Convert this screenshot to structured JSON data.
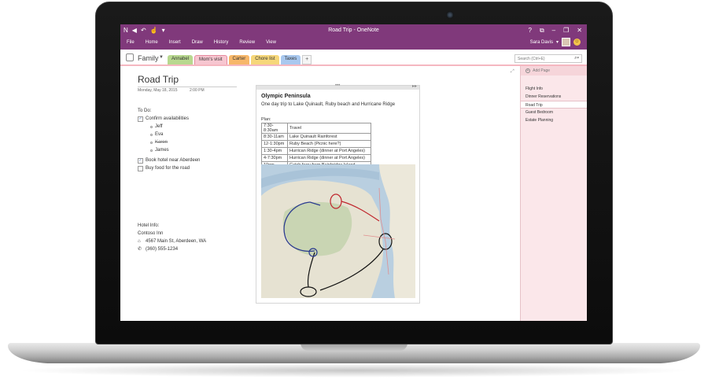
{
  "window": {
    "title": "Road Trip - OneNote",
    "qat_icons": [
      "onenote-logo-icon",
      "back-icon",
      "undo-icon",
      "touch-mode-icon",
      "customize-icon"
    ],
    "controls": [
      "help-icon",
      "fullscreen-icon",
      "minimize-icon",
      "restore-icon",
      "close-icon"
    ]
  },
  "ribbon": {
    "tabs": [
      "File",
      "Home",
      "Insert",
      "Draw",
      "History",
      "Review",
      "View"
    ],
    "user_name": "Sara Davis"
  },
  "notebook": {
    "name": "Family",
    "sections": [
      {
        "label": "Annabel",
        "color": "#b8d88f"
      },
      {
        "label": "Mom's visit",
        "color": "#f7c6d0"
      },
      {
        "label": "Carter",
        "color": "#f7b76a"
      },
      {
        "label": "Chore list",
        "color": "#f6d77a"
      },
      {
        "label": "Taxes",
        "color": "#a9c8ef"
      }
    ],
    "add_section": "+",
    "active_section": 1,
    "search_placeholder": "Search (Ctrl+E)"
  },
  "page": {
    "title": "Road Trip",
    "date": "Monday, May 18, 2015",
    "time": "2:00 PM",
    "todo_label": "To Do:",
    "todo": [
      {
        "text": "Confirm availabilities",
        "checked": true
      },
      {
        "text": "Jeff",
        "sub": true
      },
      {
        "text": "Eva",
        "sub": true
      },
      {
        "text": "Karen",
        "sub": true,
        "strike": true
      },
      {
        "text": "James",
        "sub": true
      },
      {
        "text": "Book hotel near Aberdeen",
        "checked": true
      },
      {
        "text": "Buy food for the road",
        "checked": false
      }
    ],
    "hotel_label": "Hotel Info:",
    "hotel_name": "Contoso Inn",
    "hotel_address": "4567 Main St, Aberdeen, WA",
    "hotel_phone": "(360) 555-1234"
  },
  "container": {
    "title": "Olympic Peninsula",
    "subtitle": "One day trip to Lake Quinault, Ruby beach and Hurricane Ridge",
    "plan_label": "Plan:",
    "plan": [
      [
        "7:30-8:30am",
        "Travel"
      ],
      [
        "8:30-11am",
        "Lake Quinault Rainforest"
      ],
      [
        "12-1:30pm",
        "Ruby Beach (Picnic here?)"
      ],
      [
        "1:30-4pm",
        "Hurrican Ridge (dinner at Port Angeles)"
      ],
      [
        "4-7:30pm",
        "Hurrican Ridge (dinner at Port Angeles)"
      ],
      [
        "10pm",
        "Catch ferry from Bainbridge Island"
      ]
    ]
  },
  "pages": {
    "add_page": "Add Page",
    "items": [
      "Flight Info",
      "Dinner Reservations",
      "Road Trip",
      "Guest Bedroom",
      "Estate Planning"
    ],
    "active": 2
  }
}
